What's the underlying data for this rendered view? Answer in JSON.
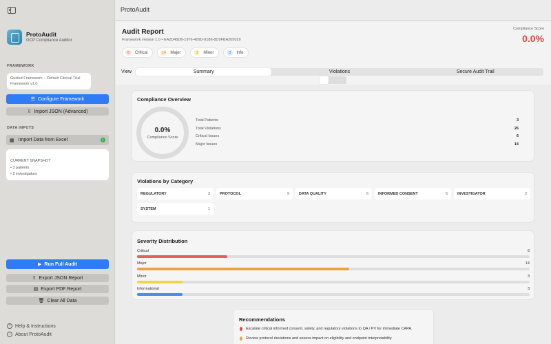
{
  "window": {
    "title": "ProtoAudit"
  },
  "sidebar": {
    "app_name": "ProtoAudit",
    "app_subtitle": "GCP Compliance Auditor",
    "framework_section": "FRAMEWORK",
    "framework_text": "Guided Framework – Default Clinical Trial Framework v1.0",
    "configure_label": "Configure Framework",
    "import_json_label": "Import JSON (Advanced)",
    "data_inputs_section": "DATA INPUTS",
    "import_excel_label": "Import Data from Excel",
    "snapshot_title": "CURRENT SNAPSHOT",
    "snapshot_patients": "• 3 patients",
    "snapshot_investigators": "• 2 investigators",
    "run_audit_label": "Run Full Audit",
    "export_json_label": "Export JSON Report",
    "export_pdf_label": "Export PDF Report",
    "clear_label": "Clear All Data",
    "help_label": "Help & Instructions",
    "about_label": "About ProtoAudit"
  },
  "report": {
    "title": "Audit Report",
    "subtitle": "Framework version 1.0 • EA2D45D6-1976-429D-9186-8D9FBA205029",
    "compliance_label": "Compliance Score",
    "compliance_value": "0.0%",
    "badges": [
      {
        "count": "6",
        "label": "Critical",
        "color": "#e5423b",
        "bg": "#fde4e2"
      },
      {
        "count": "14",
        "label": "Major",
        "color": "#d9822b",
        "bg": "#fdebd5"
      },
      {
        "count": "3",
        "label": "Minor",
        "color": "#b8a215",
        "bg": "#fbf3c9"
      },
      {
        "count": "3",
        "label": "Info",
        "color": "#2f7cf6",
        "bg": "#dde9fd"
      }
    ]
  },
  "view": {
    "label": "View",
    "tabs": [
      "Summary",
      "Violations",
      "Secure Audit Trail"
    ]
  },
  "overview": {
    "title": "Compliance Overview",
    "score": "0.0%",
    "score_label": "Compliance Score",
    "stats": [
      {
        "label": "Total Patients",
        "value": "3"
      },
      {
        "label": "Total Violations",
        "value": "26"
      },
      {
        "label": "Critical Issues",
        "value": "6"
      },
      {
        "label": "Major Issues",
        "value": "14"
      }
    ]
  },
  "categories": {
    "title": "Violations by Category",
    "items": [
      {
        "name": "REGULATORY",
        "count": "3"
      },
      {
        "name": "PROTOCOL",
        "count": "9"
      },
      {
        "name": "DATA QUALITY",
        "count": "6"
      },
      {
        "name": "INFORMED CONSENT",
        "count": "5"
      },
      {
        "name": "INVESTIGATOR",
        "count": "2"
      },
      {
        "name": "SYSTEM",
        "count": "1"
      }
    ]
  },
  "severity": {
    "title": "Severity Distribution",
    "items": [
      {
        "label": "Critical",
        "value": "6",
        "fraction": 0.23,
        "color": "#e8605a"
      },
      {
        "label": "Major",
        "value": "14",
        "fraction": 0.54,
        "color": "#eba443"
      },
      {
        "label": "Minor",
        "value": "3",
        "fraction": 0.115,
        "color": "#f0d34a"
      },
      {
        "label": "Informational",
        "value": "3",
        "fraction": 0.115,
        "color": "#4a90e2"
      }
    ]
  },
  "recommendations": {
    "title": "Recommendations",
    "items": [
      {
        "text": "Escalate critical informed consent, safety, and regulatory violations to QA / PV for immediate CAPA.",
        "color": "#e5423b"
      },
      {
        "text": "Review protocol deviations and assess impact on eligibility and endpoint interpretability.",
        "color": "#eba443"
      }
    ]
  }
}
